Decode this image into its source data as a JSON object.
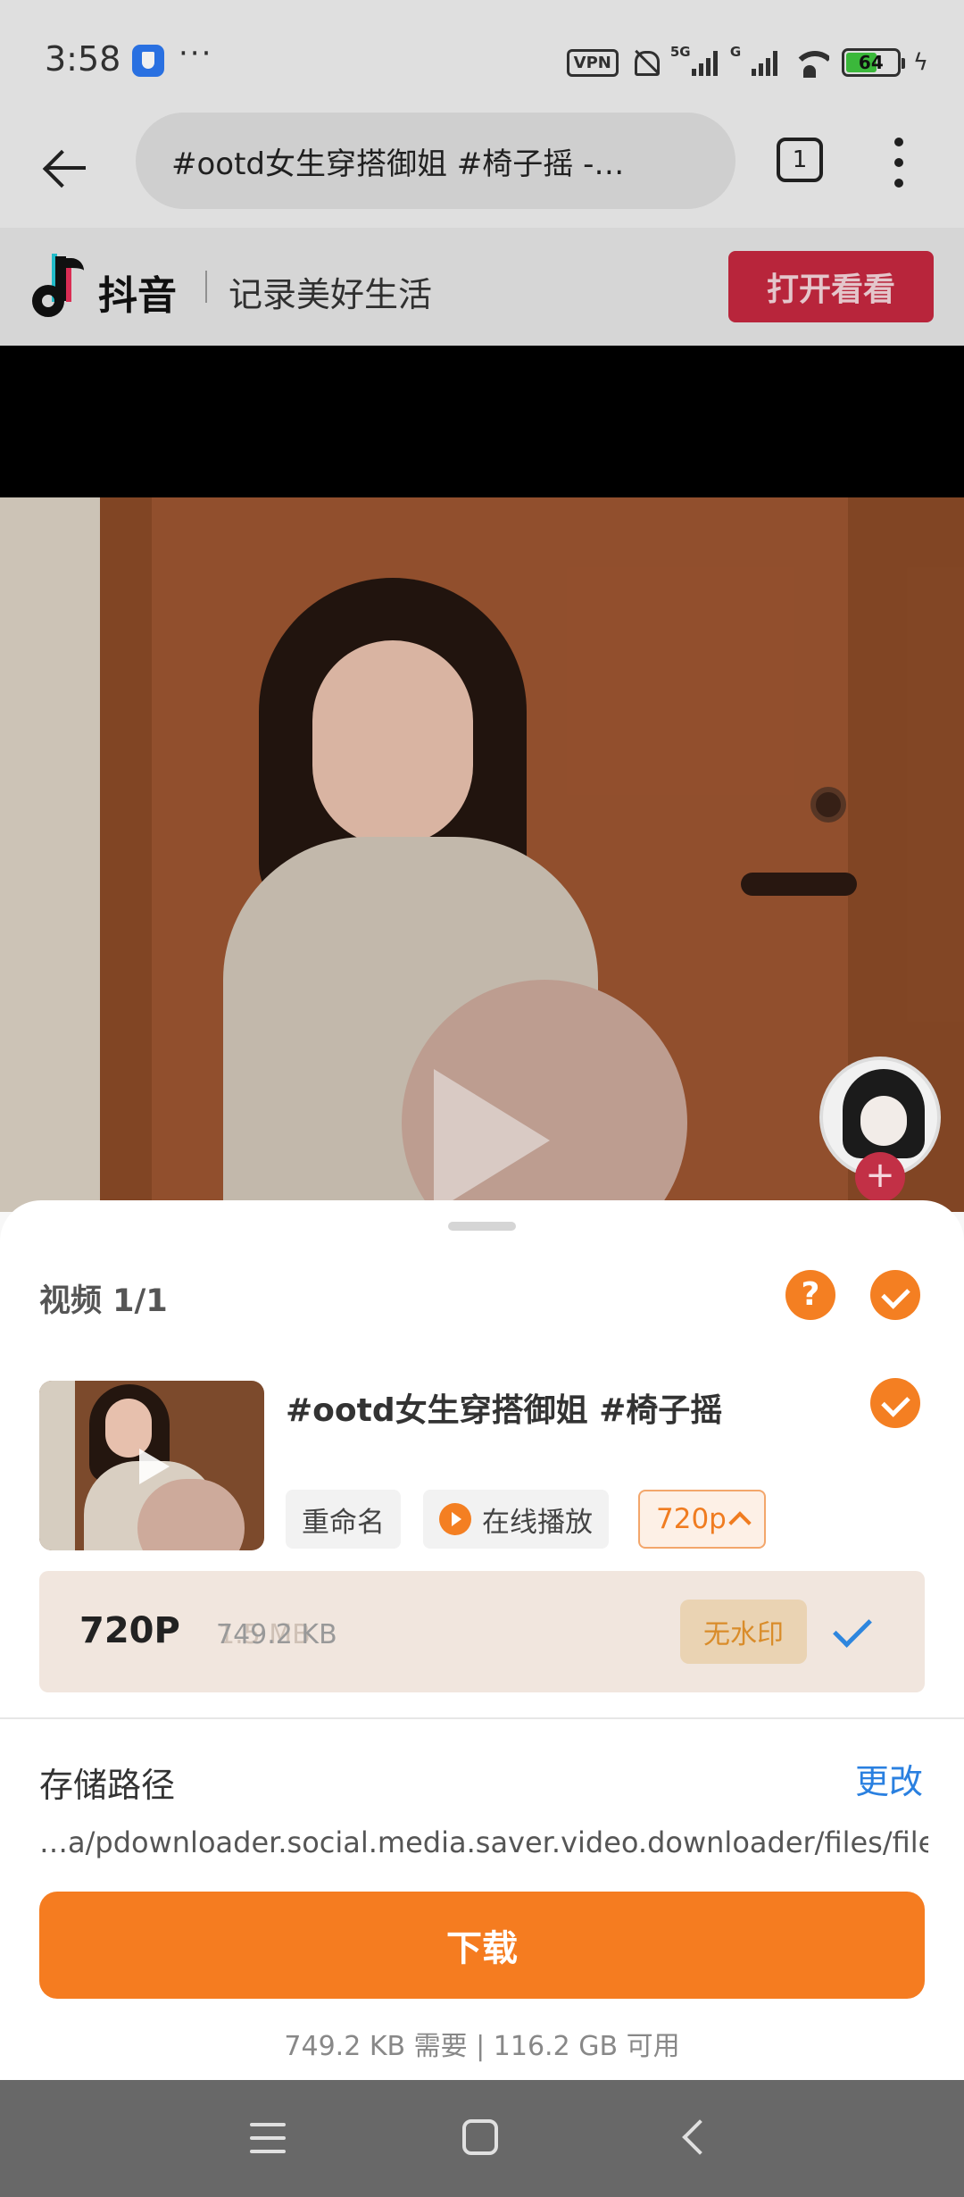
{
  "status_bar": {
    "time": "3:58",
    "more": "···",
    "vpn": "VPN",
    "network1": "5G",
    "network2": "G",
    "battery_level": 64,
    "battery_text": "64"
  },
  "browser": {
    "url_title": "#ootd女生穿搭御姐 #椅子摇 -…",
    "tab_count": "1"
  },
  "douyin": {
    "name": "抖音",
    "slogan": "记录美好生活",
    "open_button": "打开看看"
  },
  "sheet": {
    "title": "视频 1/1",
    "help": "?",
    "item": {
      "title": "#ootd女生穿搭御姐 #椅子摇",
      "rename": "重命名",
      "play_online": "在线播放",
      "quality_chip": "720p"
    },
    "quality_row": {
      "label": "720P",
      "size": "749.2 KB",
      "size_overlap": "1.5 MB",
      "watermark": "无水印"
    },
    "path_label": "存储路径",
    "change": "更改",
    "path": "…a/pdownloader.social.media.saver.video.downloader/files/file",
    "download": "下载",
    "storage": "749.2 KB 需要 | 116.2 GB 可用"
  },
  "colors": {
    "accent": "#f57c20",
    "link": "#2a80e0",
    "douyin_red": "#c4283f"
  },
  "icons": [
    "shield-icon",
    "bell-off-icon",
    "wifi-icon",
    "battery-icon",
    "back-arrow-icon",
    "more-vert-icon",
    "play-icon",
    "help-icon",
    "check-icon",
    "chevron-up-icon",
    "menu-icon",
    "home-icon",
    "nav-back-icon"
  ]
}
